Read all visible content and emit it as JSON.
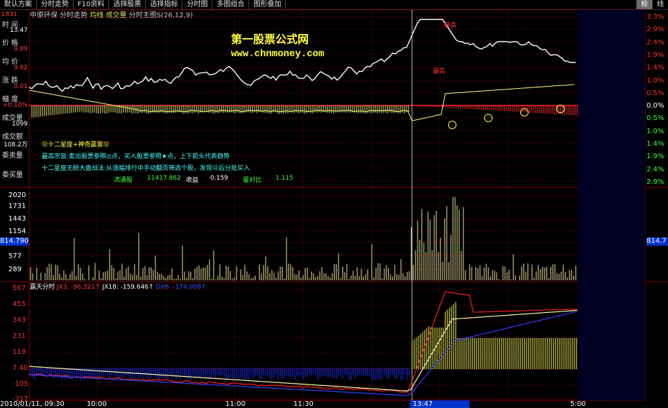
{
  "menu": {
    "items": [
      "默认方案",
      "分时走势",
      "F10资料",
      "选择股票",
      "选择指标",
      "分时图",
      "多图组合",
      "图形叠加"
    ],
    "right_items": [
      "标",
      "线"
    ]
  },
  "header": {
    "stock_name": "中原环保",
    "chart_mode": "分时走势",
    "avg_label": "均线",
    "vol_label": "成交量",
    "indicator": "分时主图S",
    "params": "(26,12,9)"
  },
  "left_panel": {
    "top_price": "1831",
    "rows": [
      {
        "label": "时 间",
        "value": "13:47",
        "color": "white"
      },
      {
        "label": "价 格",
        "value": "9.89",
        "color": "red"
      },
      {
        "label": "均 价",
        "value": "9.82",
        "color": "red"
      },
      {
        "label": "涨 跌",
        "value": "0.01",
        "color": "red"
      },
      {
        "label": "幅 度",
        "value": "+0.10%",
        "color": "red"
      },
      {
        "label": "成交量",
        "value": "1099",
        "color": "white"
      },
      {
        "label": "成交额",
        "value": "108.2万",
        "color": "white"
      },
      {
        "label": "委卖量",
        "value": "",
        "color": "white"
      },
      {
        "label": "委买量",
        "value": "",
        "color": "white"
      }
    ]
  },
  "price_axis": [
    "3.3%",
    "2.9%",
    "2.4%",
    "1.9%",
    "1.4%",
    "1.0%",
    "0.5%",
    "0.0%",
    "0.5%",
    "1.0%",
    "1.4%",
    "1.9%",
    "2.4%",
    "2.9%"
  ],
  "watermark": {
    "title": "第一股票公式网",
    "url": "www.chnmoney.com"
  },
  "annotations": {
    "line1": "⑫十二星座+神奇赢富⑫",
    "line2": "最高宗旨:卖出股票参照◎点，买入股票参照★点，上下箭头代表趋势",
    "line3": "十二星座无统大盘战法:从涨幅排行中手动翻页筛选个股，发现⑫后分批买入",
    "stats_label1": "流通股",
    "stats_val1": "11417.862",
    "stats_label2": "收益",
    "stats_val2": "0.159",
    "stats_label3": "量对比",
    "stats_val3": "1.115",
    "marker_high": "最高",
    "marker_top": "最高"
  },
  "volume_axis": [
    "2020",
    "1731",
    "1443",
    "1154",
    "577",
    "289"
  ],
  "volume_marker": "814.790",
  "volume_marker_right": "814.7",
  "indicator": {
    "name": "赢天分时",
    "jx3": "JX3: -96.321↑",
    "jx18": "JX18: -159.646↑",
    "dx6": "DX6: -174.008↑"
  },
  "indicator_axis": [
    "567",
    "455",
    "343",
    "231",
    "119",
    "7.40",
    "-105",
    "-217"
  ],
  "time_axis": {
    "date": "2010/01/11, 09:30",
    "t1": "10:00",
    "t2": "11:00",
    "t3": "11:30",
    "cursor": "13:47",
    "t4": "5:00"
  },
  "colors": {
    "red": "#ff3030",
    "grid": "#8b0000",
    "yellow": "#ffff60",
    "blue": "#2030ff"
  }
}
